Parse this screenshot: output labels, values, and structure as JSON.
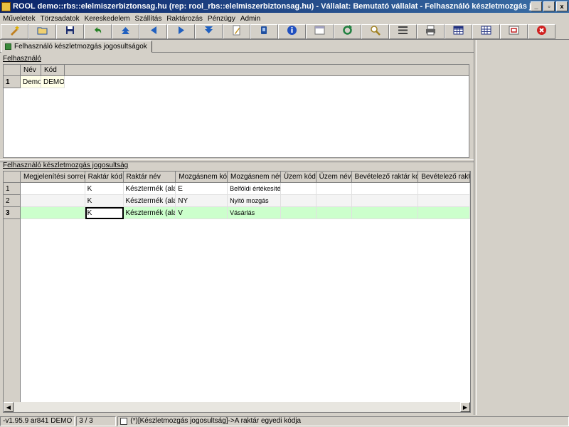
{
  "window": {
    "title": "ROOL demo::rbs::elelmiszerbiztonsag.hu (rep: rool_rbs::elelmiszerbiztonsag.hu) - Vállalat: Bemutató vállalat - Felhasználó készletmozgás jogosultságok",
    "controls": [
      "_",
      "▫",
      "x"
    ]
  },
  "menu": [
    "Műveletek",
    "Törzsadatok",
    "Kereskedelem",
    "Szállítás",
    "Raktározás",
    "Pénzügy",
    "Admin"
  ],
  "toolbar": [
    {
      "icon": "wizard-icon",
      "color": "#c08020"
    },
    {
      "icon": "open-folder-icon",
      "color": "#2050a0"
    },
    {
      "icon": "save-disk-icon",
      "color": "#203070"
    },
    {
      "icon": "undo-arrow-icon",
      "color": "#208020"
    },
    {
      "icon": "first-record-icon",
      "color": "#2060c0"
    },
    {
      "icon": "previous-record-icon",
      "color": "#2060c0"
    },
    {
      "icon": "next-record-icon",
      "color": "#2060c0"
    },
    {
      "icon": "last-record-icon",
      "color": "#2060c0"
    },
    {
      "icon": "edit-pencil-icon",
      "color": "#c09020"
    },
    {
      "icon": "copy-icon",
      "color": "#2050a0"
    },
    {
      "icon": "info-icon",
      "color": "#2050c0"
    },
    {
      "icon": "form-view-icon",
      "color": "#707070"
    },
    {
      "icon": "refresh-icon",
      "color": "#208040"
    },
    {
      "icon": "search-icon",
      "color": "#a08020"
    },
    {
      "icon": "list-icon",
      "color": "#404040"
    },
    {
      "icon": "print-icon",
      "color": "#606060"
    },
    {
      "icon": "table-grid-icon",
      "color": "#203080"
    },
    {
      "icon": "columns-icon",
      "color": "#203080"
    },
    {
      "icon": "export-icon",
      "color": "#c02020"
    },
    {
      "icon": "close-icon",
      "color": "#d02020"
    }
  ],
  "tab": {
    "label": "Felhasználó készletmozgás jogosultságok"
  },
  "section1": {
    "label": "Felhasználó",
    "columns": [
      "Név",
      "Kód"
    ],
    "rows": [
      {
        "num": "1",
        "cells": [
          "Demo",
          "DEMO"
        ]
      }
    ]
  },
  "section2": {
    "label": "Felhasználó készletmozgás jogosultság",
    "columns": [
      "Megjelenítési sorrend",
      "Raktár kód",
      "Raktár név",
      "Mozgásnem kód",
      "Mozgásnem név",
      "Üzem kód",
      "Üzem név",
      "Bevételező raktár kód",
      "Bevételező raktá"
    ],
    "rows": [
      {
        "num": "1",
        "cells": [
          "",
          "K",
          "Késztermék (alap)",
          "E",
          "Belföldi értékesítés",
          "",
          "",
          "",
          ""
        ]
      },
      {
        "num": "2",
        "cells": [
          "",
          "K",
          "Késztermék (alap)",
          "NY",
          "Nyitó mozgás",
          "",
          "",
          "",
          ""
        ]
      },
      {
        "num": "3",
        "cells": [
          "",
          "K",
          "Késztermék (alap)",
          "V",
          "Vásárlás",
          "",
          "",
          "",
          ""
        ]
      }
    ]
  },
  "status": {
    "version": "-v1.95.9 ar841 DEMO",
    "record": "3 / 3",
    "hint": "(*)[Készletmozgás jogosultság]->A raktár egyedi kódja"
  }
}
